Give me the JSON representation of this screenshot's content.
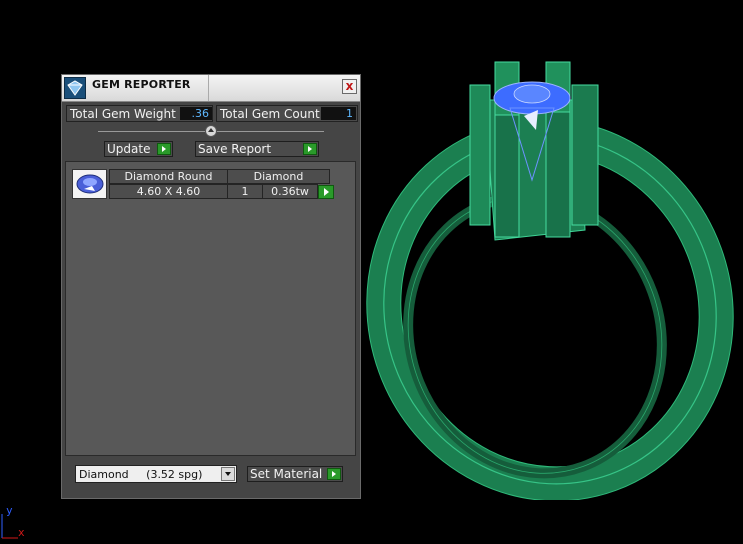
{
  "panel": {
    "title": "GEM REPORTER",
    "close_label": "x",
    "total_weight_label": "Total Gem Weight",
    "total_weight_value": ".36",
    "total_count_label": "Total Gem Count",
    "total_count_value": "1",
    "update_label": "Update",
    "save_report_label": "Save Report"
  },
  "gems": [
    {
      "shape": "Diamond Round",
      "size": "4.60 X 4.60",
      "material": "Diamond",
      "count": "1",
      "weight": "0.36tw"
    }
  ],
  "material_select": {
    "value": "Diamond     (3.52 spg)"
  },
  "set_material_label": "Set Material",
  "axis": {
    "y_label": "y",
    "x_label": "x",
    "y_color": "#2f5fff",
    "x_color": "#d01818"
  },
  "colors": {
    "ring": "#1d8a56",
    "gem": "#3d6cff",
    "accent_green": "#2a9a2a"
  }
}
